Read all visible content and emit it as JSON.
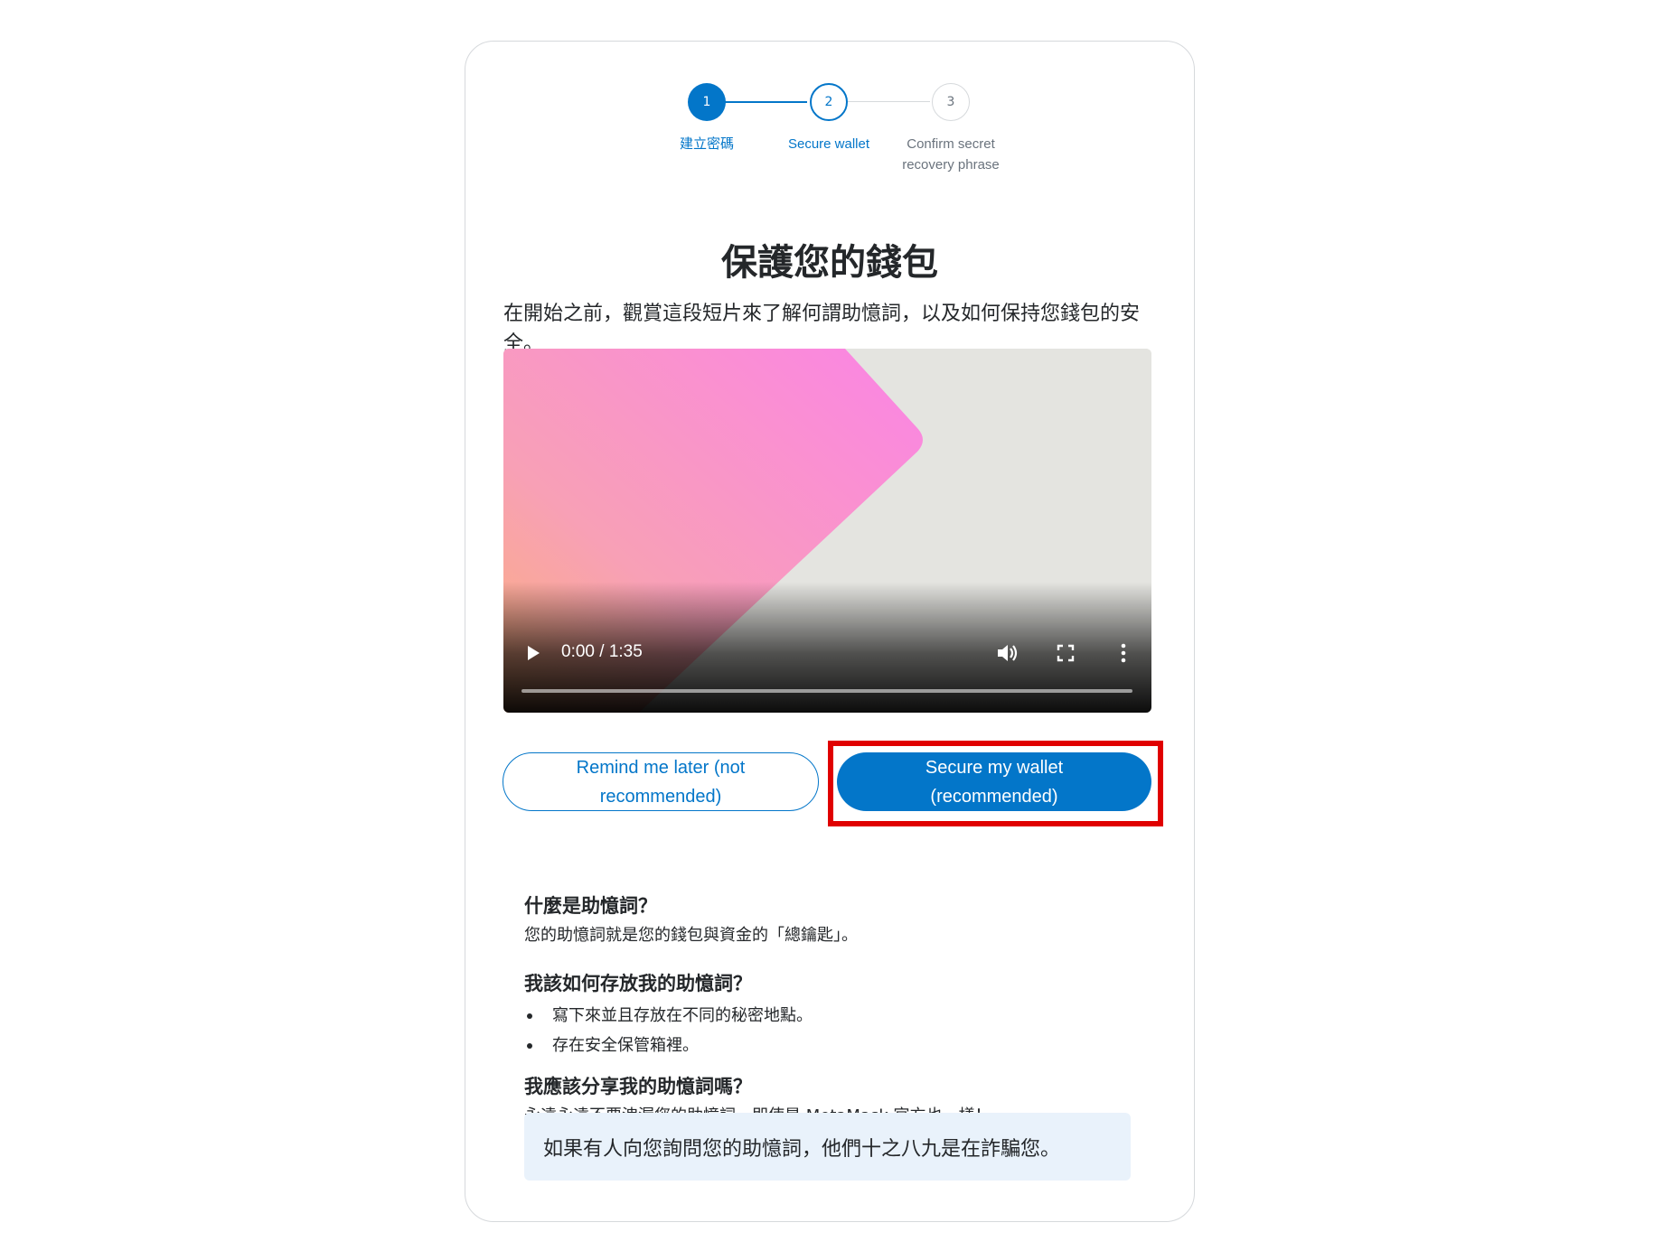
{
  "stepper": {
    "steps": [
      {
        "number": "1",
        "label": "建立密碼"
      },
      {
        "number": "2",
        "label": "Secure wallet"
      },
      {
        "number": "3",
        "label": "Confirm secret recovery phrase"
      }
    ]
  },
  "page": {
    "title": "保護您的錢包",
    "intro": "在開始之前，觀賞這段短片來了解何謂助憶詞，以及如何保持您錢包的安全。"
  },
  "video": {
    "time": "0:00 / 1:35",
    "progress": 0.0,
    "icons": [
      "play-icon",
      "volume-icon",
      "fullscreen-icon",
      "more-options-icon"
    ]
  },
  "actions": {
    "remind_label": "Remind me later (not recommended)",
    "secure_label": "Secure my wallet (recommended)"
  },
  "faq": {
    "q1": "什麼是助憶詞？",
    "a1": "您的助憶詞就是您的錢包與資金的「總鑰匙」。",
    "q2": "我該如何存放我的助憶詞？",
    "a2_items": [
      "寫下來並且存放在不同的秘密地點。",
      "存在安全保管箱裡。"
    ],
    "q3": "我應該分享我的助憶詞嗎？",
    "a3": "永遠永遠不要洩漏您的助憶詞，即使是 MetaMask 官方也一樣！"
  },
  "notice": "如果有人向您詢問您的助憶詞，他們十之八九是在詐騙您。",
  "colors": {
    "accent": "#0376c9",
    "highlight": "#e00000",
    "notice_bg": "#e9f2fb"
  }
}
